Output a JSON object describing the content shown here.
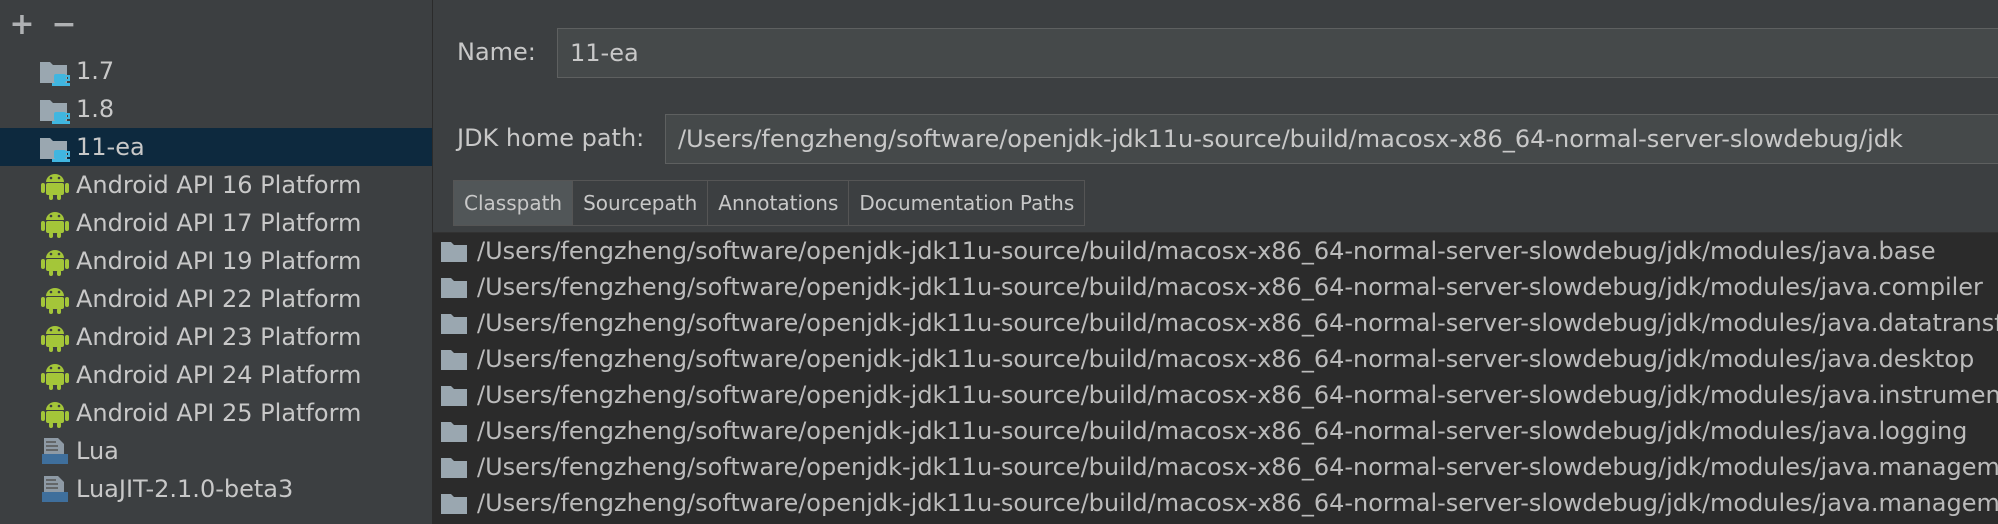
{
  "toolbar": {
    "add_symbol": "+",
    "remove_symbol": "−"
  },
  "sdks": [
    {
      "label": "1.7",
      "icon": "jdk-folder-icon",
      "selected": false
    },
    {
      "label": "1.8",
      "icon": "jdk-folder-icon",
      "selected": false
    },
    {
      "label": "11-ea",
      "icon": "jdk-folder-icon",
      "selected": true
    },
    {
      "label": "Android API 16 Platform",
      "icon": "android-icon",
      "selected": false
    },
    {
      "label": "Android API 17 Platform",
      "icon": "android-icon",
      "selected": false
    },
    {
      "label": "Android API 19 Platform",
      "icon": "android-icon",
      "selected": false
    },
    {
      "label": "Android API 22 Platform",
      "icon": "android-icon",
      "selected": false
    },
    {
      "label": "Android API 23 Platform",
      "icon": "android-icon",
      "selected": false
    },
    {
      "label": "Android API 24 Platform",
      "icon": "android-icon",
      "selected": false
    },
    {
      "label": "Android API 25 Platform",
      "icon": "android-icon",
      "selected": false
    },
    {
      "label": "Lua",
      "icon": "lua-sdk-icon",
      "selected": false
    },
    {
      "label": "LuaJIT-2.1.0-beta3",
      "icon": "lua-sdk-icon",
      "selected": false
    }
  ],
  "form": {
    "name_label": "Name:",
    "name_value": "11-ea",
    "home_label": "JDK home path:",
    "home_value": "/Users/fengzheng/software/openjdk-jdk11u-source/build/macosx-x86_64-normal-server-slowdebug/jdk"
  },
  "tabs": [
    {
      "label": "Classpath",
      "active": true
    },
    {
      "label": "Sourcepath",
      "active": false
    },
    {
      "label": "Annotations",
      "active": false
    },
    {
      "label": "Documentation Paths",
      "active": false
    }
  ],
  "classpath": [
    "/Users/fengzheng/software/openjdk-jdk11u-source/build/macosx-x86_64-normal-server-slowdebug/jdk/modules/java.base",
    "/Users/fengzheng/software/openjdk-jdk11u-source/build/macosx-x86_64-normal-server-slowdebug/jdk/modules/java.compiler",
    "/Users/fengzheng/software/openjdk-jdk11u-source/build/macosx-x86_64-normal-server-slowdebug/jdk/modules/java.datatransfer",
    "/Users/fengzheng/software/openjdk-jdk11u-source/build/macosx-x86_64-normal-server-slowdebug/jdk/modules/java.desktop",
    "/Users/fengzheng/software/openjdk-jdk11u-source/build/macosx-x86_64-normal-server-slowdebug/jdk/modules/java.instrument",
    "/Users/fengzheng/software/openjdk-jdk11u-source/build/macosx-x86_64-normal-server-slowdebug/jdk/modules/java.logging",
    "/Users/fengzheng/software/openjdk-jdk11u-source/build/macosx-x86_64-normal-server-slowdebug/jdk/modules/java.management",
    "/Users/fengzheng/software/openjdk-jdk11u-source/build/macosx-x86_64-normal-server-slowdebug/jdk/modules/java.management.rmi"
  ],
  "colors": {
    "background": "#3c3f41",
    "list_background": "#2b2b2b",
    "selection": "#0d293e",
    "android_green": "#a4c639",
    "folder_gray": "#9aa7b0",
    "cup_blue": "#40b6e0"
  }
}
